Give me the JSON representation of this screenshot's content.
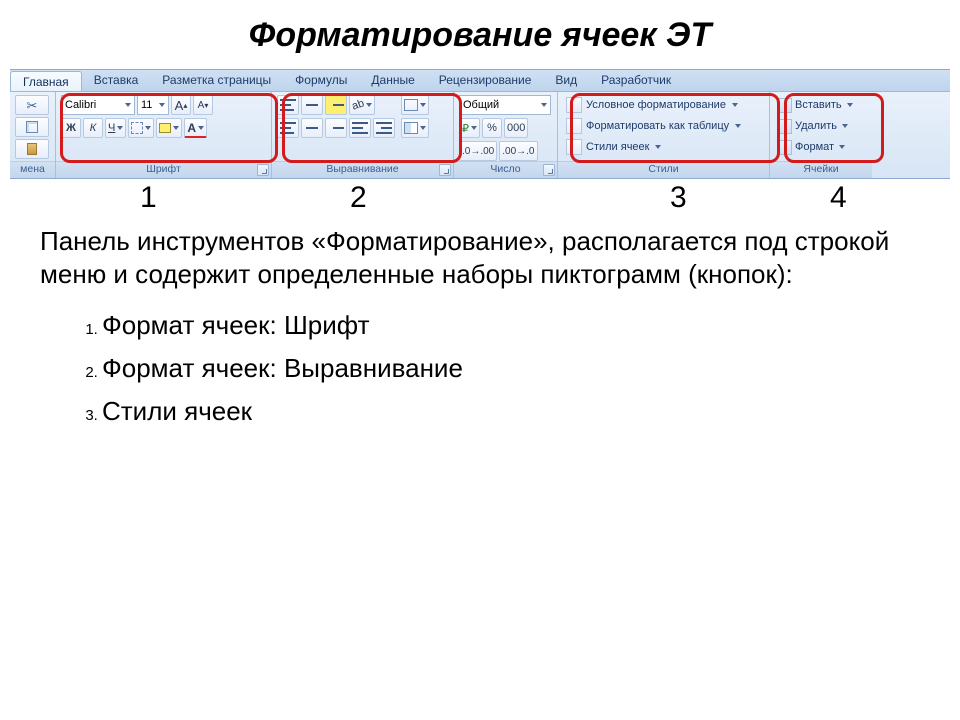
{
  "title": "Форматирование ячеек ЭТ",
  "tabs": [
    "Главная",
    "Вставка",
    "Разметка страницы",
    "Формулы",
    "Данные",
    "Рецензирование",
    "Вид",
    "Разработчик"
  ],
  "groups": {
    "clipboard_partial_label": "мена",
    "font": {
      "label": "Шрифт",
      "font_name": "Calibri",
      "font_size": "11",
      "bold": "Ж",
      "italic": "К",
      "underline": "Ч",
      "grow": "A",
      "shrink": "A"
    },
    "alignment": {
      "label": "Выравнивание"
    },
    "number": {
      "label": "Число",
      "format": "Общий",
      "percent": "%",
      "thousands": "000"
    },
    "styles": {
      "label": "Стили",
      "conditional": "Условное форматирование",
      "as_table": "Форматировать как таблицу",
      "cell_styles": "Стили ячеек"
    },
    "cells": {
      "label": "Ячейки",
      "insert": "Вставить",
      "delete": "Удалить",
      "format": "Формат"
    }
  },
  "numbers": {
    "n1": "1",
    "n2": "2",
    "n3": "3",
    "n4": "4"
  },
  "paragraph": "Панель инструментов «Форматирование», располагается под строкой меню и содержит определенные наборы пиктограмм (кнопок):",
  "list": [
    "Формат ячеек: Шрифт",
    "Формат ячеек: Выравнивание",
    "Стили ячеек"
  ]
}
